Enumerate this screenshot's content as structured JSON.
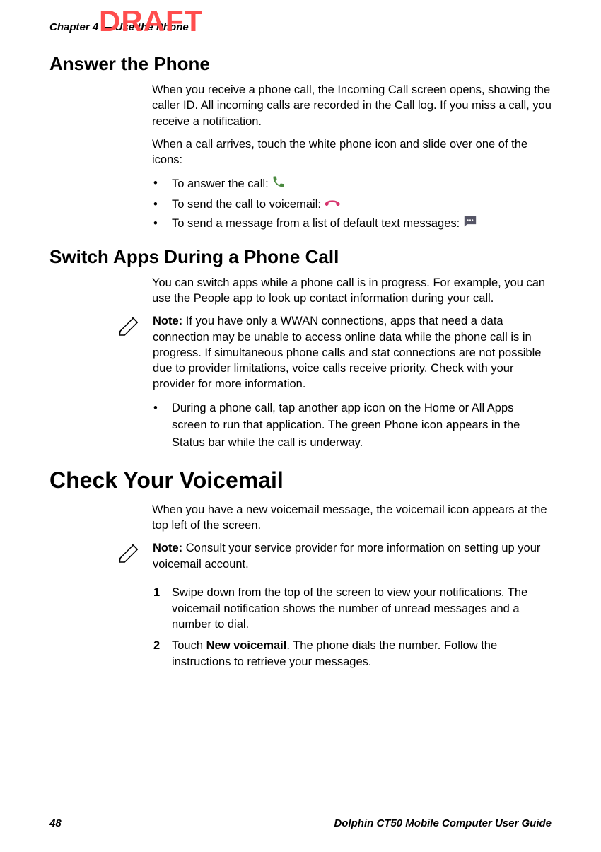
{
  "watermark": "DRAFT",
  "running_header": "Chapter 4 — Use the Phone",
  "footer": {
    "page_number": "48",
    "guide_title": "Dolphin CT50 Mobile Computer User Guide"
  },
  "section_answer": {
    "heading": "Answer the Phone",
    "p1": "When you receive a phone call, the Incoming Call screen opens, showing the caller ID. All incoming calls are recorded in the Call log. If you miss a call, you receive a notification.",
    "p2": "When a call arrives, touch the white phone icon and slide over one of the icons:",
    "bullets": {
      "b1": "To answer the call: ",
      "b2": "To send the call to voicemail: ",
      "b3": "To send a message from a list of default text messages: "
    },
    "icons": {
      "answer": "phone-answer-icon",
      "voicemail": "phone-hangup-icon",
      "message": "message-icon"
    }
  },
  "section_switch": {
    "heading": "Switch Apps During a Phone Call",
    "p1": "You can switch apps while a phone call is in progress. For example, you can use the People app to look up contact information during your call.",
    "note_label": "Note:",
    "note_text": " If you have only a WWAN connections, apps that need a data connection may be unable to access online data while the phone call is in progress. If simultaneous phone calls and stat connections are not possible due to provider limitations, voice calls receive priority. Check with your provider for more information.",
    "bullet": "During a phone call, tap another app icon on the Home or All Apps screen to run that application. The green Phone icon appears in the Status bar while the call is underway."
  },
  "section_voicemail": {
    "heading": "Check Your Voicemail",
    "p1": "When you have a new voicemail message, the voicemail icon appears at the top left of the screen.",
    "note_label": "Note:",
    "note_text": " Consult your service provider for more information on setting up your voicemail account.",
    "step1": "Swipe down from the top of the screen to view your notifications. The voicemail notification shows the number of unread messages and a number to dial.",
    "step2_prefix": "Touch ",
    "step2_bold": "New voicemail",
    "step2_suffix": ". The phone dials the number. Follow the instructions to retrieve your messages."
  }
}
